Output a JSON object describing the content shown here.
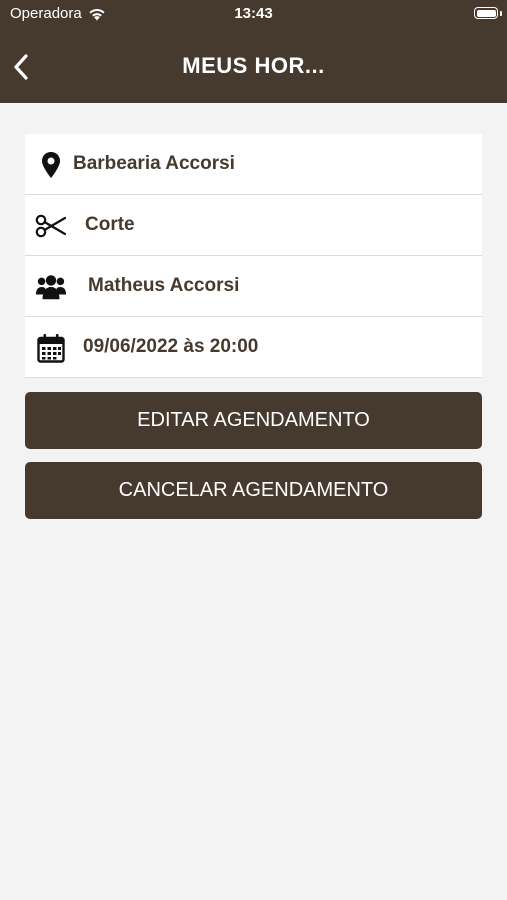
{
  "status_bar": {
    "carrier": "Operadora",
    "time": "13:43"
  },
  "header": {
    "title": "MEUS HOR...",
    "background": "#463a2e"
  },
  "details": [
    {
      "icon": "map-pin-icon",
      "text": "Barbearia Accorsi"
    },
    {
      "icon": "scissors-icon",
      "text": "Corte"
    },
    {
      "icon": "users-icon",
      "text": "Matheus Accorsi"
    },
    {
      "icon": "calendar-icon",
      "text": "09/06/2022 às 20:00"
    }
  ],
  "actions": {
    "edit_label": "EDITAR AGENDAMENTO",
    "cancel_label": "CANCELAR AGENDAMENTO"
  },
  "colors": {
    "brand": "#463a2e",
    "background": "#f3f3f3",
    "card": "#ffffff"
  }
}
